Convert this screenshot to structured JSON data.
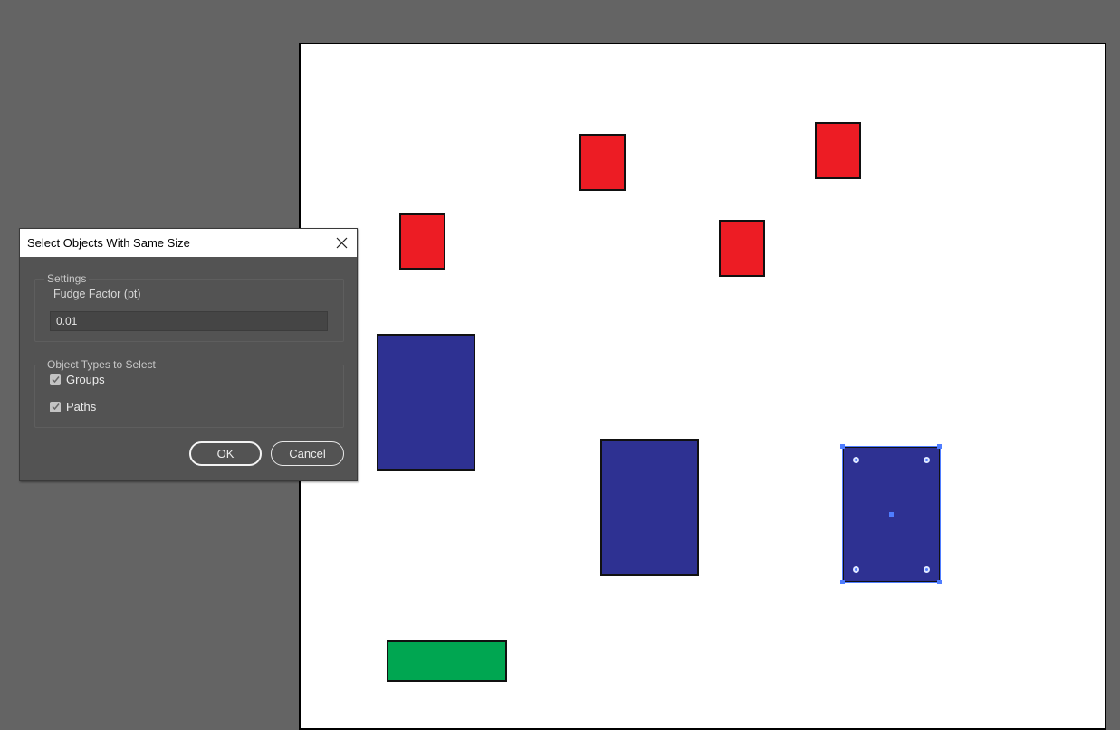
{
  "dialog": {
    "title": "Select Objects With Same Size",
    "close_icon": "close-icon",
    "settings": {
      "legend": "Settings",
      "fudge_factor_label": "Fudge Factor (pt)",
      "fudge_factor_value": "0.01"
    },
    "object_types": {
      "legend": "Object Types to Select",
      "options": [
        {
          "label": "Groups",
          "checked": true
        },
        {
          "label": "Paths",
          "checked": true
        }
      ]
    },
    "ok_label": "OK",
    "cancel_label": "Cancel"
  },
  "canvas": {
    "colors": {
      "red": "#ed1c24",
      "blue": "#2e3192",
      "green": "#00a651",
      "selection": "#4f7dff"
    },
    "shapes": [
      {
        "name": "red-rectangle",
        "color": "red"
      },
      {
        "name": "red-rectangle",
        "color": "red"
      },
      {
        "name": "red-rectangle",
        "color": "red"
      },
      {
        "name": "red-rectangle",
        "color": "red"
      },
      {
        "name": "blue-rectangle",
        "color": "blue"
      },
      {
        "name": "blue-rectangle",
        "color": "blue"
      },
      {
        "name": "blue-rectangle",
        "color": "blue",
        "selected": true
      },
      {
        "name": "green-rectangle",
        "color": "green"
      }
    ]
  }
}
